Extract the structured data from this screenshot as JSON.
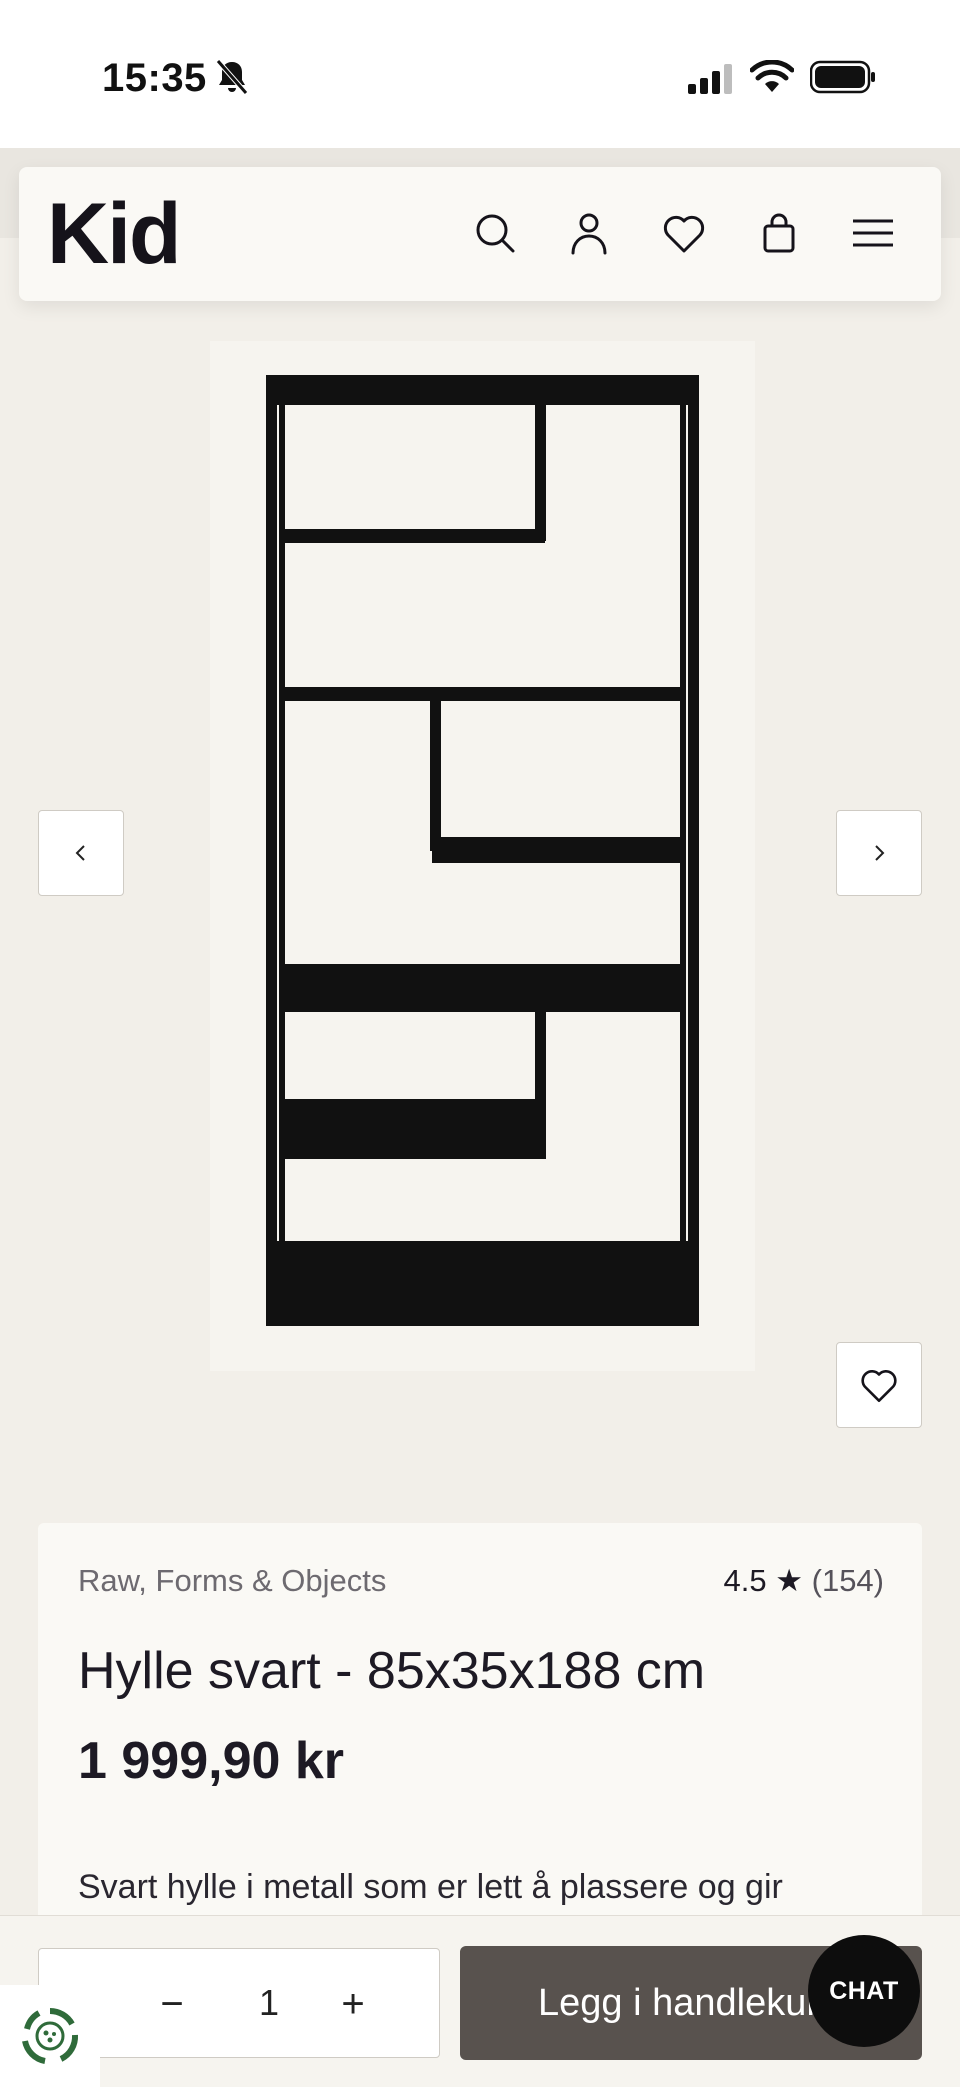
{
  "status_bar": {
    "time": "15:35",
    "icons": [
      "bell-muted-icon",
      "signal-icon",
      "wifi-icon",
      "battery-icon"
    ]
  },
  "header": {
    "logo": "Kid",
    "icons": [
      "search-icon",
      "account-icon",
      "wishlist-icon",
      "bag-icon",
      "menu-icon"
    ]
  },
  "gallery": {
    "prev_icon": "chevron-left-icon",
    "next_icon": "chevron-right-icon",
    "favorite_icon": "heart-icon"
  },
  "product": {
    "brand": "Raw, Forms & Objects",
    "rating_value": "4.5",
    "rating_star": "★",
    "rating_count": "(154)",
    "title": "Hylle svart - 85x35x188 cm",
    "price": "1 999,90 kr",
    "description": "Svart hylle i metall som er lett å plassere og gir"
  },
  "cart_bar": {
    "minus": "−",
    "quantity": "1",
    "plus": "+",
    "add_label": "Legg i handlekurv",
    "chat_label": "CHAT"
  },
  "colors": {
    "page_bg": "#f2efe9",
    "card_bg": "#faf9f5",
    "button_dark": "#58524e",
    "chat_bg": "#0d0d0d",
    "text": "#1d1a24"
  }
}
